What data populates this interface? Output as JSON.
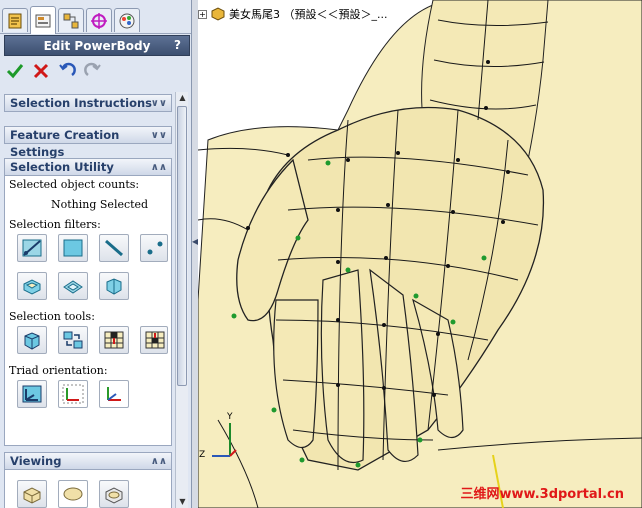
{
  "property_manager": {
    "title": "Edit PowerBody",
    "help": "?",
    "tabs": [
      "feature-manager-icon",
      "property-manager-icon",
      "configuration-manager-icon",
      "dimxpert-icon",
      "display-manager-icon"
    ],
    "actions": [
      "ok-check-icon",
      "cancel-x-icon",
      "undo-icon",
      "redo-icon"
    ]
  },
  "groups": {
    "selection_instructions": {
      "label": "Selection Instructions",
      "state": "collapsed"
    },
    "feature_creation": {
      "label": "Feature Creation Settings",
      "state": "collapsed"
    },
    "selection_utility": {
      "label": "Selection Utility",
      "state": "expanded",
      "counts_label": "Selected object counts:",
      "counts_value": "Nothing Selected",
      "filters_label": "Selection filters:",
      "tools_label": "Selection tools:",
      "triad_label": "Triad orientation:"
    },
    "viewing": {
      "label": "Viewing",
      "state": "expanded"
    }
  },
  "viewport": {
    "tree_text": "美女馬尾3 （預設＜＜預設＞_...",
    "watermark": "三维网www.3dportal.cn",
    "triad_axes": {
      "y": "Y",
      "z": "Z"
    }
  },
  "colors": {
    "body": "#f6edbf",
    "mesh": "#1a1a1a",
    "accent": "#3c4f70",
    "vertex_green": "#1f9a2e"
  }
}
